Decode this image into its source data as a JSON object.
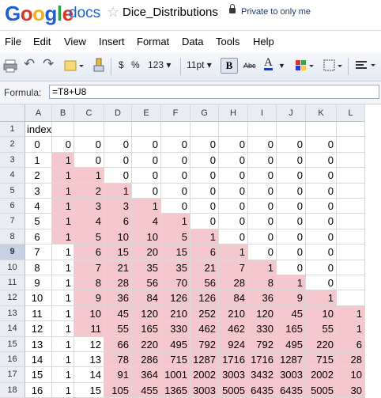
{
  "app": {
    "logo": "Google",
    "product": "docs",
    "doc_title": "Dice_Distributions",
    "privacy": "Private to only me"
  },
  "menus": [
    "File",
    "Edit",
    "View",
    "Insert",
    "Format",
    "Data",
    "Tools",
    "Help"
  ],
  "toolbar": {
    "currency": "$",
    "percent": "%",
    "number_format": "123 ▾",
    "font_size": "11pt ▾",
    "bold": "B",
    "strike": "Abc",
    "text_color": "A"
  },
  "formula": {
    "label": "Formula:",
    "value": "=T8+U8"
  },
  "selected_row": "9",
  "columns": [
    "A",
    "B",
    "C",
    "D",
    "E",
    "F",
    "G",
    "H",
    "I",
    "J",
    "K",
    "L"
  ],
  "rows": [
    {
      "n": "1",
      "cells": [
        "index",
        "",
        "",
        "",
        "",
        "",
        "",
        "",
        "",
        "",
        "",
        ""
      ]
    },
    {
      "n": "2",
      "cells": [
        "0",
        "0",
        "0",
        "0",
        "0",
        "0",
        "0",
        "0",
        "0",
        "0",
        "0",
        ""
      ]
    },
    {
      "n": "3",
      "cells": [
        "1",
        "1",
        "0",
        "0",
        "0",
        "0",
        "0",
        "0",
        "0",
        "0",
        "0",
        ""
      ]
    },
    {
      "n": "4",
      "cells": [
        "2",
        "1",
        "1",
        "0",
        "0",
        "0",
        "0",
        "0",
        "0",
        "0",
        "0",
        ""
      ]
    },
    {
      "n": "5",
      "cells": [
        "3",
        "1",
        "2",
        "1",
        "0",
        "0",
        "0",
        "0",
        "0",
        "0",
        "0",
        ""
      ]
    },
    {
      "n": "6",
      "cells": [
        "4",
        "1",
        "3",
        "3",
        "1",
        "0",
        "0",
        "0",
        "0",
        "0",
        "0",
        ""
      ]
    },
    {
      "n": "7",
      "cells": [
        "5",
        "1",
        "4",
        "6",
        "4",
        "1",
        "0",
        "0",
        "0",
        "0",
        "0",
        ""
      ]
    },
    {
      "n": "8",
      "cells": [
        "6",
        "1",
        "5",
        "10",
        "10",
        "5",
        "1",
        "0",
        "0",
        "0",
        "0",
        ""
      ]
    },
    {
      "n": "9",
      "cells": [
        "7",
        "1",
        "6",
        "15",
        "20",
        "15",
        "6",
        "1",
        "0",
        "0",
        "0",
        ""
      ]
    },
    {
      "n": "10",
      "cells": [
        "8",
        "1",
        "7",
        "21",
        "35",
        "35",
        "21",
        "7",
        "1",
        "0",
        "0",
        ""
      ]
    },
    {
      "n": "11",
      "cells": [
        "9",
        "1",
        "8",
        "28",
        "56",
        "70",
        "56",
        "28",
        "8",
        "1",
        "0",
        ""
      ]
    },
    {
      "n": "12",
      "cells": [
        "10",
        "1",
        "9",
        "36",
        "84",
        "126",
        "126",
        "84",
        "36",
        "9",
        "1",
        ""
      ]
    },
    {
      "n": "13",
      "cells": [
        "11",
        "1",
        "10",
        "45",
        "120",
        "210",
        "252",
        "210",
        "120",
        "45",
        "10",
        "1"
      ]
    },
    {
      "n": "14",
      "cells": [
        "12",
        "1",
        "11",
        "55",
        "165",
        "330",
        "462",
        "462",
        "330",
        "165",
        "55",
        "1"
      ]
    },
    {
      "n": "15",
      "cells": [
        "13",
        "1",
        "12",
        "66",
        "220",
        "495",
        "792",
        "924",
        "792",
        "495",
        "220",
        "6"
      ]
    },
    {
      "n": "16",
      "cells": [
        "14",
        "1",
        "13",
        "78",
        "286",
        "715",
        "1287",
        "1716",
        "1716",
        "1287",
        "715",
        "28"
      ]
    },
    {
      "n": "17",
      "cells": [
        "15",
        "1",
        "14",
        "91",
        "364",
        "1001",
        "2002",
        "3003",
        "3432",
        "3003",
        "2002",
        "10"
      ]
    },
    {
      "n": "18",
      "cells": [
        "16",
        "1",
        "15",
        "105",
        "455",
        "1365",
        "3003",
        "5005",
        "6435",
        "6435",
        "5005",
        "30"
      ]
    }
  ],
  "colors": {
    "highlight": "#f4c7cc",
    "header_bg": "#e9edf3",
    "selected_header": "#c5d1e4"
  }
}
